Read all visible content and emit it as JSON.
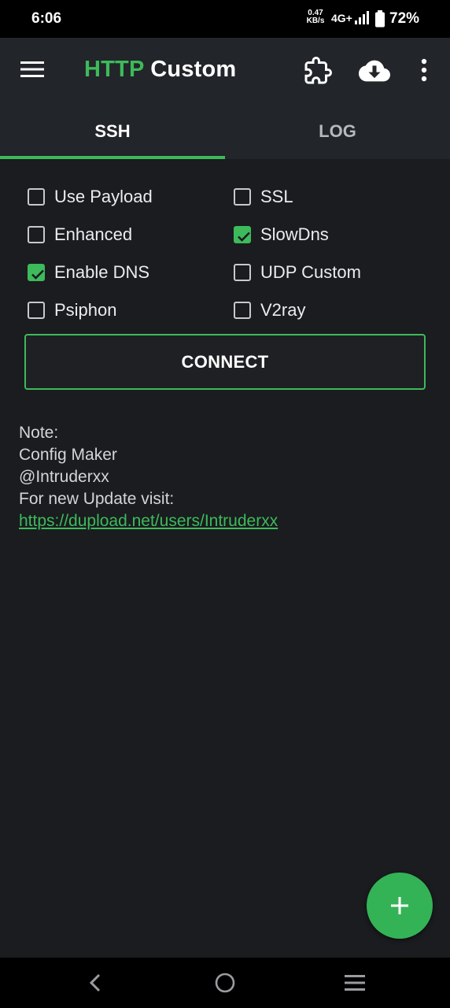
{
  "status_bar": {
    "time": "6:06",
    "speed_value": "0.47",
    "speed_unit": "KB/s",
    "network": "4G+",
    "battery_pct": "72%"
  },
  "app_bar": {
    "title_accent": "HTTP",
    "title_rest": " Custom",
    "accent_color": "#3dba5b"
  },
  "tabs": [
    {
      "label": "SSH",
      "active": true
    },
    {
      "label": "LOG",
      "active": false
    }
  ],
  "options": [
    {
      "label": "Use Payload",
      "checked": false
    },
    {
      "label": "SSL",
      "checked": false
    },
    {
      "label": "Enhanced",
      "checked": false
    },
    {
      "label": "SlowDns",
      "checked": true
    },
    {
      "label": "Enable DNS",
      "checked": true
    },
    {
      "label": "UDP Custom",
      "checked": false
    },
    {
      "label": "Psiphon",
      "checked": false
    },
    {
      "label": "V2ray",
      "checked": false
    }
  ],
  "connect_label": "CONNECT",
  "note": {
    "line1": "Note:",
    "line2": "Config Maker",
    "line3": "@Intruderxx",
    "line4": "For new Update visit:",
    "link": "https://dupload.net/users/Intruderxx"
  },
  "icons": {
    "menu": "menu-icon",
    "puzzle": "puzzle-icon",
    "cloud": "cloud-download-icon",
    "more": "more-vert-icon",
    "fab": "plus-icon",
    "nav_back": "back-icon",
    "nav_home": "home-icon",
    "nav_recents": "recents-icon"
  }
}
